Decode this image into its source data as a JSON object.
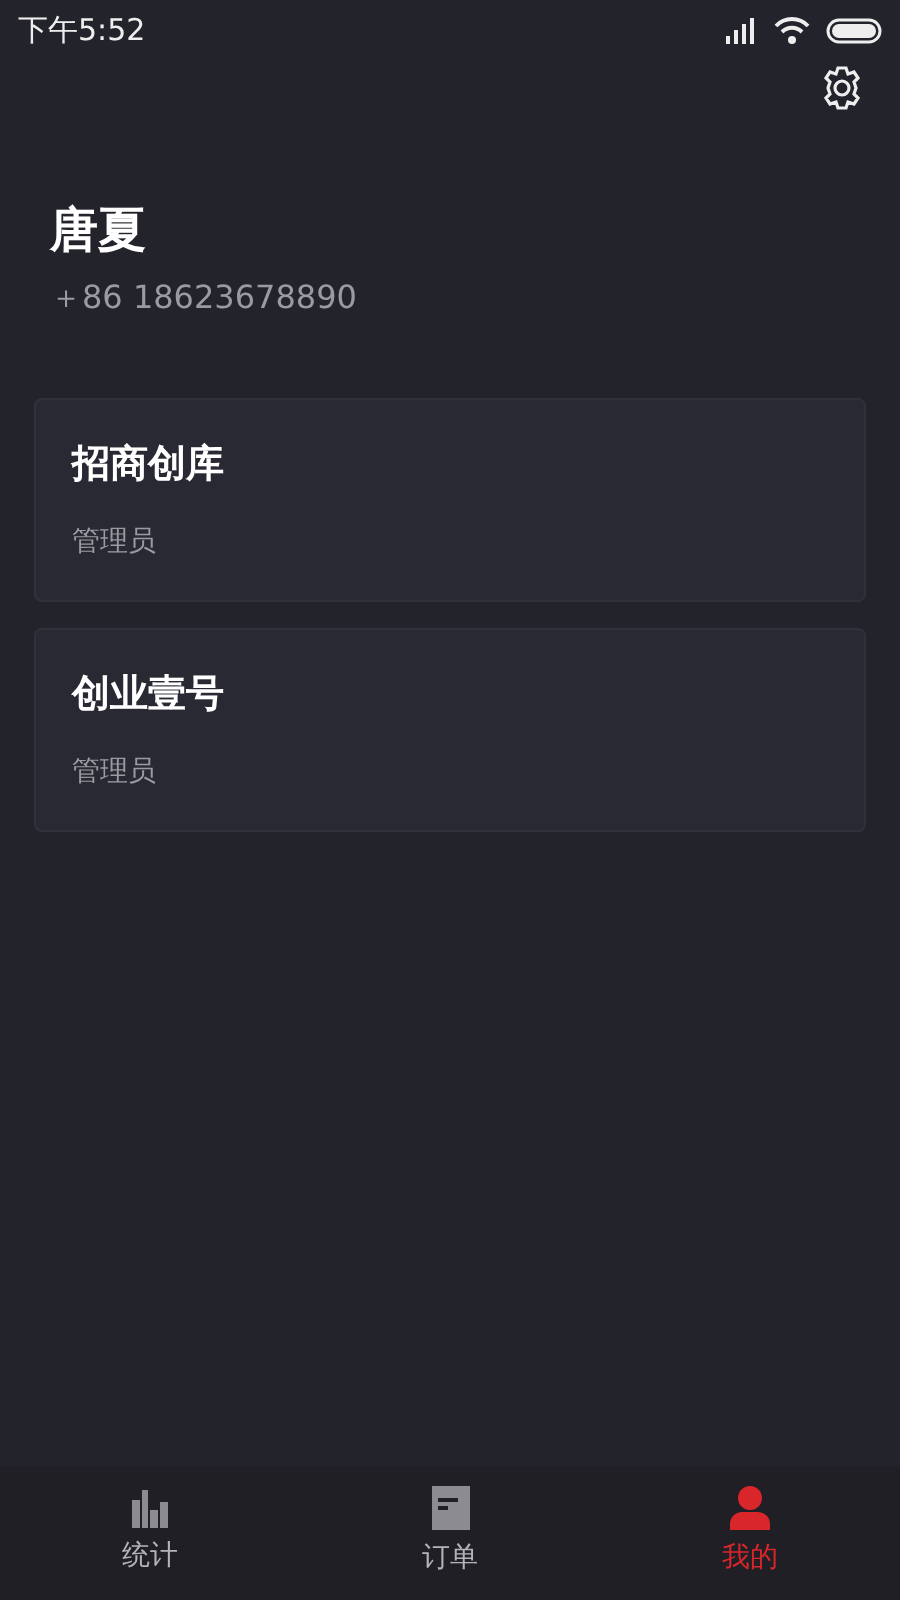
{
  "status_bar": {
    "time": "下午5:52"
  },
  "profile": {
    "name": "唐夏",
    "phone": "＋86 18623678890"
  },
  "companies": [
    {
      "name": "招商创库",
      "role": "管理员"
    },
    {
      "name": "创业壹号",
      "role": "管理员"
    }
  ],
  "tab_bar": [
    {
      "label": "统计",
      "selected": false
    },
    {
      "label": "订单",
      "selected": false
    },
    {
      "label": "我的",
      "selected": true
    }
  ]
}
